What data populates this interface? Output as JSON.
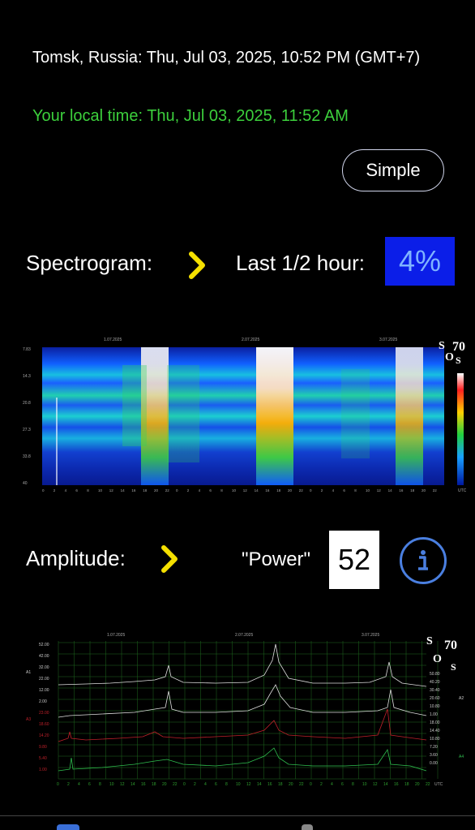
{
  "header": {
    "location_time": "Tomsk, Russia: Thu, Jul 03, 2025, 10:52 PM (GMT+7)",
    "local_time": "Your local time: Thu, Jul 03, 2025, 11:52 AM"
  },
  "mode_button": {
    "label": "Simple"
  },
  "spectrogram": {
    "label": "Spectrogram:",
    "period_label": "Last 1/2 hour:",
    "percent": "4%",
    "date_labels": [
      "1.07.2025",
      "2.07.2025",
      "3.07.2025"
    ],
    "y_ticks": [
      "7.83",
      "14.3",
      "20.8",
      "27.3",
      "33.8",
      "40"
    ],
    "hour_ticks": [
      "0",
      "2",
      "4",
      "6",
      "8",
      "10",
      "12",
      "14",
      "16",
      "18",
      "20",
      "22"
    ],
    "x_unit": "UTC",
    "logo_letters": [
      "S",
      "O",
      "S"
    ],
    "logo_number": "70"
  },
  "amplitude": {
    "label": "Amplitude:",
    "power_label": "\"Power\"",
    "power_value": "52",
    "date_labels": [
      "1.07.2025",
      "2.07.2025",
      "3.07.2025"
    ],
    "y_left": [
      "52.00",
      "42.00",
      "32.00",
      "22.00",
      "12.00",
      "2.00",
      "23.00",
      "18.60",
      "14.20",
      "9.80",
      "5.40",
      "1.00"
    ],
    "y_right": [
      "50.80",
      "40.20",
      "30.40",
      "20.60",
      "10.80",
      "1.00",
      "18.00",
      "14.40",
      "10.80",
      "7.20",
      "3.60",
      "0.00"
    ],
    "side_labels": [
      "A1",
      "A2",
      "A3",
      "A4"
    ],
    "hour_ticks": [
      "0",
      "2",
      "4",
      "6",
      "8",
      "10",
      "12",
      "14",
      "16",
      "18",
      "20",
      "22"
    ],
    "x_unit": "UTC",
    "logo_letters": [
      "S",
      "O",
      "S"
    ],
    "logo_number": "70"
  },
  "colors": {
    "local_time": "#3ccf3c",
    "percent_bg": "#0b1ee8",
    "chevron": "#f5e000",
    "info": "#4a7fe0"
  }
}
